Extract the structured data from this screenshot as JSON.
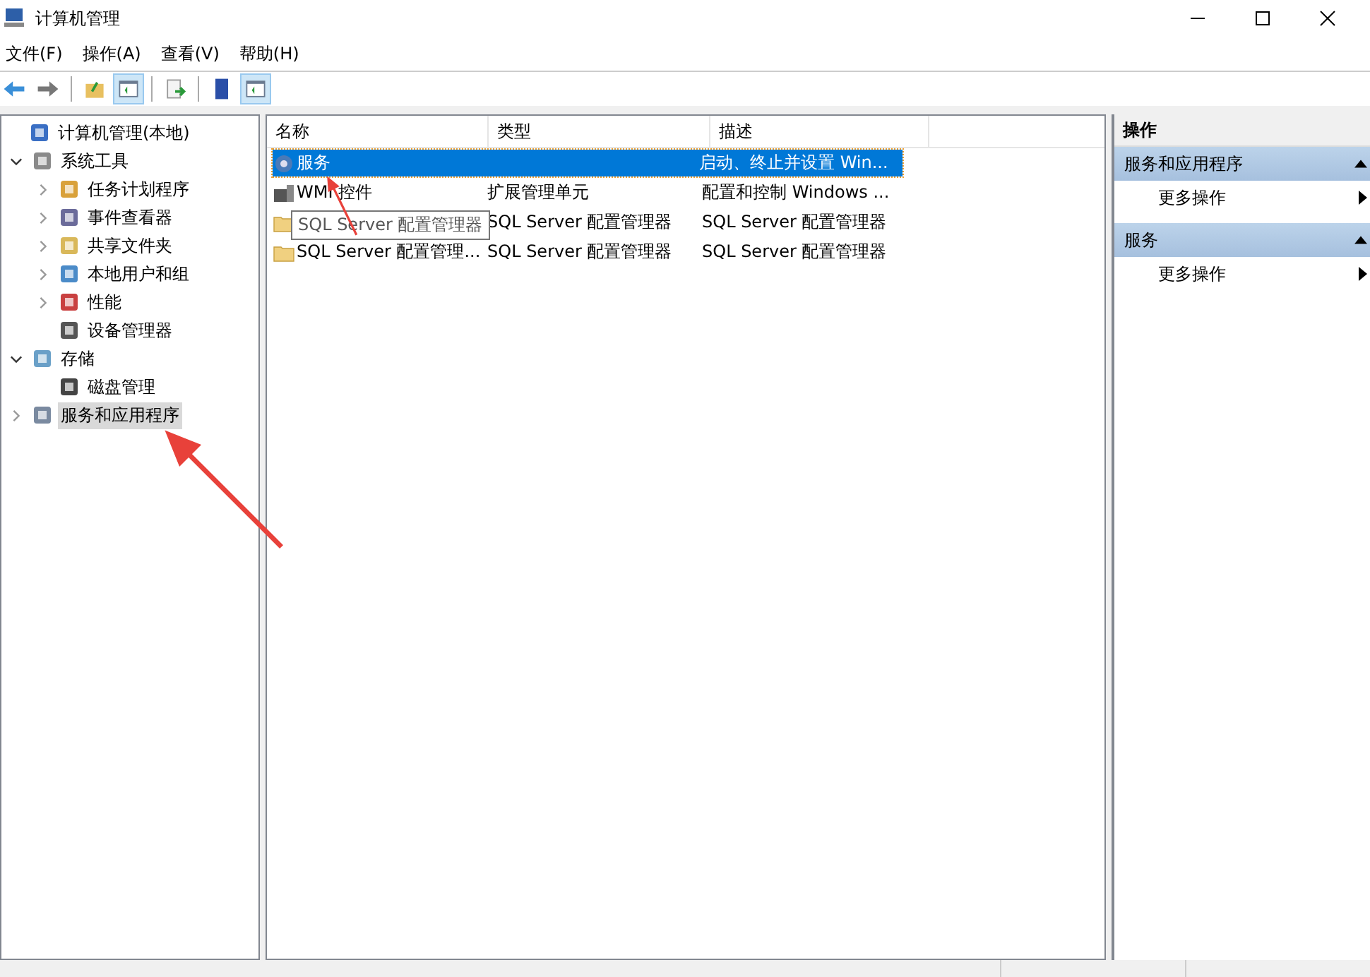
{
  "window": {
    "title": "计算机管理"
  },
  "menu": [
    "文件(F)",
    "操作(A)",
    "查看(V)",
    "帮助(H)"
  ],
  "toolbar": [
    {
      "pressed": false
    },
    {
      "pressed": false
    },
    {
      "pressed": false
    },
    {
      "pressed": true
    },
    {
      "pressed": false
    },
    {
      "pressed": false
    },
    {
      "pressed": true
    }
  ],
  "tree": [
    {
      "label": "计算机管理(本地)",
      "selected": false,
      "children": [
        {
          "label": "系统工具",
          "selected": false,
          "expanded": true,
          "children": [
            {
              "label": "任务计划程序",
              "selected": false,
              "expanded": false
            },
            {
              "label": "事件查看器",
              "selected": false,
              "expanded": false
            },
            {
              "label": "共享文件夹",
              "selected": false,
              "expanded": false
            },
            {
              "label": "本地用户和组",
              "selected": false,
              "expanded": false
            },
            {
              "label": "性能",
              "selected": false,
              "expanded": false
            },
            {
              "label": "设备管理器",
              "selected": false
            }
          ]
        },
        {
          "label": "存储",
          "selected": false,
          "expanded": true,
          "children": [
            {
              "label": "磁盘管理",
              "selected": false
            }
          ]
        },
        {
          "label": "服务和应用程序",
          "selected": true,
          "expanded": false
        }
      ]
    }
  ],
  "table": {
    "columns": [
      "名称",
      "类型",
      "描述"
    ],
    "rows": [
      {
        "name": "服务",
        "type": "",
        "description": "启动、终止并设置 Win...",
        "selected": true
      },
      {
        "name": "WMI 控件",
        "type": "扩展管理单元",
        "description": "配置和控制 Windows ...",
        "selected": false
      },
      {
        "name": "",
        "type": "SQL Server 配置管理器",
        "description": "SQL Server 配置管理器",
        "selected": false
      },
      {
        "name": "SQL Server 配置管理...",
        "type": "SQL Server 配置管理器",
        "description": "SQL Server 配置管理器",
        "selected": false
      }
    ],
    "tooltip": "SQL Server 配置管理器"
  },
  "actions": {
    "title": "操作",
    "sections": [
      {
        "title": "服务和应用程序",
        "items": [
          "更多操作"
        ]
      },
      {
        "title": "服务",
        "items": [
          "更多操作"
        ]
      }
    ]
  }
}
